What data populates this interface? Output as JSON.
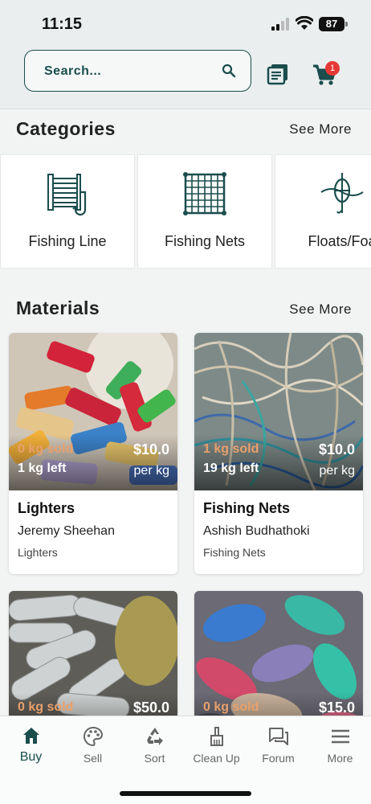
{
  "status_bar": {
    "time": "11:15",
    "battery": "87"
  },
  "header": {
    "search_placeholder": "Search...",
    "cart_count": "1",
    "icons": {
      "search": "search-icon",
      "orders": "orders-list-icon",
      "cart": "cart-icon"
    }
  },
  "categories": {
    "title": "Categories",
    "see_more": "See More",
    "items": [
      {
        "label": "Fishing Line",
        "icon": "fishing-line-icon"
      },
      {
        "label": "Fishing Nets",
        "icon": "fishing-net-icon"
      },
      {
        "label": "Floats/Foa",
        "icon": "float-icon"
      }
    ]
  },
  "materials": {
    "title": "Materials",
    "see_more": "See More",
    "items": [
      {
        "sold": "0 kg sold",
        "left": "1 kg left",
        "price": "$10.0",
        "unit": "per kg",
        "title": "Lighters",
        "seller": "Jeremy Sheehan",
        "category": "Lighters"
      },
      {
        "sold": "1 kg sold",
        "left": "19 kg left",
        "price": "$10.0",
        "unit": "per kg",
        "title": "Fishing Nets",
        "seller": "Ashish Budhathoki",
        "category": "Fishing Nets"
      },
      {
        "sold": "0 kg sold",
        "price": "$50.0"
      },
      {
        "sold": "0 kg sold",
        "price": "$15.0"
      }
    ]
  },
  "nav": {
    "items": [
      {
        "label": "Buy",
        "icon": "home-icon",
        "active": true
      },
      {
        "label": "Sell",
        "icon": "palette-icon"
      },
      {
        "label": "Sort",
        "icon": "recycle-icon"
      },
      {
        "label": "Clean Up",
        "icon": "broom-icon"
      },
      {
        "label": "Forum",
        "icon": "forum-icon"
      },
      {
        "label": "More",
        "icon": "menu-icon"
      }
    ]
  },
  "colors": {
    "accent": "#1b4d4d",
    "badge": "#e53935",
    "sold_text": "#e8a06c"
  }
}
